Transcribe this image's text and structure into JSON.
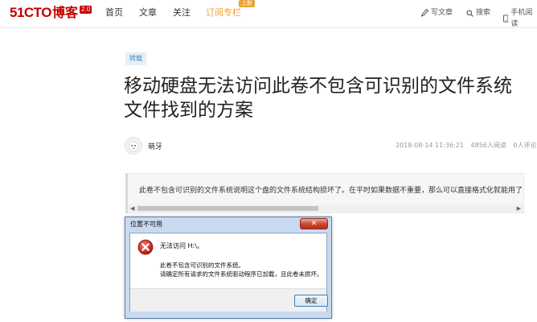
{
  "nav": {
    "logo_mark": "51CTO",
    "logo_text": "博客",
    "logo_version": "2.0",
    "links": [
      "首页",
      "文章",
      "关注",
      "订阅专栏"
    ],
    "badge": "上新",
    "write": "写文章",
    "search": "搜索",
    "mobile": "手机阅读"
  },
  "article": {
    "tag": "转载",
    "title": "移动硬盘无法访问此卷不包含可识别的文件系统文件找到的方案",
    "author": "萌牙",
    "date": "2018-08-14 11:36:21",
    "views": "4856人阅读",
    "comments": "0人评论",
    "quote": "此卷不包含可识别的文件系统说明这个盘的文件系统结构损坏了。在平时如果数据不重要，那么可以直接格式化就能用了"
  },
  "dialog": {
    "title": "位置不可用",
    "close": "✕",
    "message1": "无法访问 H:\\。",
    "message2_line1": "此卷不包含可识别的文件系统。",
    "message2_line2": "请确定所有请求的文件系统驱动程序已加载，且此卷未损坏。",
    "ok": "确定"
  },
  "colors": {
    "brand": "#c40000",
    "accent": "#e8a33b",
    "tag_text": "#3a88c5"
  }
}
